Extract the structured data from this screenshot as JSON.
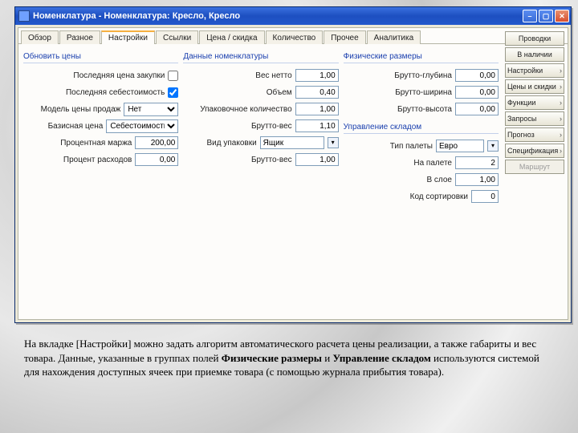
{
  "window": {
    "title": "Номенклатура - Номенклатура: Кресло, Кресло"
  },
  "tabs": [
    "Обзор",
    "Разное",
    "Настройки",
    "Ссылки",
    "Цена / скидка",
    "Количество",
    "Прочее",
    "Аналитика"
  ],
  "active_tab": 2,
  "groups": {
    "price": {
      "title": "Обновить цены",
      "rows": {
        "last_purchase": "Последняя цена закупки",
        "last_cost": "Последняя себестоимость",
        "sales_price_model": "Модель цены продаж",
        "sales_price_model_val": "Нет",
        "base_price": "Базисная цена",
        "base_price_val": "Себестоимость",
        "markup": "Процентная маржа",
        "markup_val": "200,00",
        "expense": "Процент расходов",
        "expense_val": "0,00"
      }
    },
    "data": {
      "title": "Данные номенклатуры",
      "rows": {
        "net": "Вес нетто",
        "net_val": "1,00",
        "vol": "Объем",
        "vol_val": "0,40",
        "packqty": "Упаковочное количество",
        "packqty_val": "1,00",
        "gross": "Брутто-вес",
        "gross_val": "1,10",
        "packtype": "Вид упаковки",
        "packtype_val": "Ящик",
        "gross2": "Брутто-вес",
        "gross2_val": "1,00"
      }
    },
    "phys": {
      "title": "Физические размеры",
      "rows": {
        "depth": "Брутто-глубина",
        "depth_val": "0,00",
        "width": "Брутто-ширина",
        "width_val": "0,00",
        "height": "Брутто-высота",
        "height_val": "0,00"
      }
    },
    "wh": {
      "title": "Управление складом",
      "rows": {
        "pallet_type": "Тип палеты",
        "pallet_type_val": "Евро",
        "on_pallet": "На палете",
        "on_pallet_val": "2",
        "in_layer": "В слое",
        "in_layer_val": "1,00",
        "sort": "Код сортировки",
        "sort_val": "0"
      }
    }
  },
  "sidebar": [
    {
      "label": "Проводки",
      "chev": false
    },
    {
      "label": "В наличии",
      "chev": false
    },
    {
      "label": "Настройки",
      "chev": true
    },
    {
      "label": "Цены и скидки",
      "chev": true
    },
    {
      "label": "Функции",
      "chev": true
    },
    {
      "label": "Запросы",
      "chev": true
    },
    {
      "label": "Прогноз",
      "chev": true
    },
    {
      "label": "Спецификация",
      "chev": true
    },
    {
      "label": "Маршрут",
      "chev": false,
      "disabled": true
    }
  ],
  "caption": {
    "p1a": "На вкладке [Настройки] можно задать алгоритм автоматического расчета цены реализации, а также габариты и вес товара. Данные, указанные в группах полей ",
    "b1": "Физические размеры",
    "p1b": " и ",
    "b2": "Управление складом",
    "p1c": " используются системой для нахождения доступных ячеек при приемке товара (с помощью журнала прибытия товара)."
  }
}
